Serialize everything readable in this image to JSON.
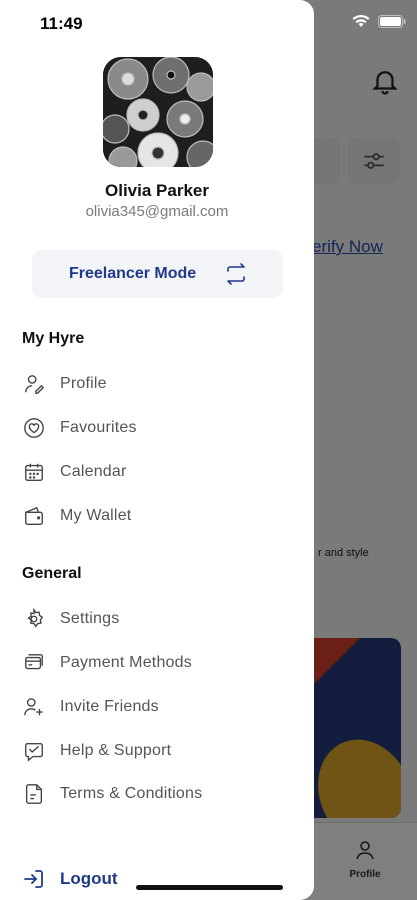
{
  "status_bar": {
    "time": "11:49"
  },
  "user": {
    "name": "Olivia Parker",
    "email": "olivia345@gmail.com"
  },
  "mode_button": {
    "label": "Freelancer Mode"
  },
  "sections": {
    "my_hyre": {
      "title": "My Hyre",
      "items": [
        {
          "label": "Profile",
          "icon": "user-edit-icon"
        },
        {
          "label": "Favourites",
          "icon": "heart-icon"
        },
        {
          "label": "Calendar",
          "icon": "calendar-icon"
        },
        {
          "label": "My Wallet",
          "icon": "wallet-icon"
        }
      ]
    },
    "general": {
      "title": "General",
      "items": [
        {
          "label": "Settings",
          "icon": "gear-icon"
        },
        {
          "label": "Payment Methods",
          "icon": "card-icon"
        },
        {
          "label": "Invite Friends",
          "icon": "add-user-icon"
        },
        {
          "label": "Help & Support",
          "icon": "support-icon"
        },
        {
          "label": "Terms & Conditions",
          "icon": "document-icon"
        }
      ]
    }
  },
  "logout": {
    "label": "Logout"
  },
  "background": {
    "verify_link": "erify Now",
    "snippet": "r and style",
    "profile_tab": "Profile"
  },
  "colors": {
    "accent": "#1f3a8a",
    "text_muted": "#555555",
    "email": "#7a7a7a"
  }
}
